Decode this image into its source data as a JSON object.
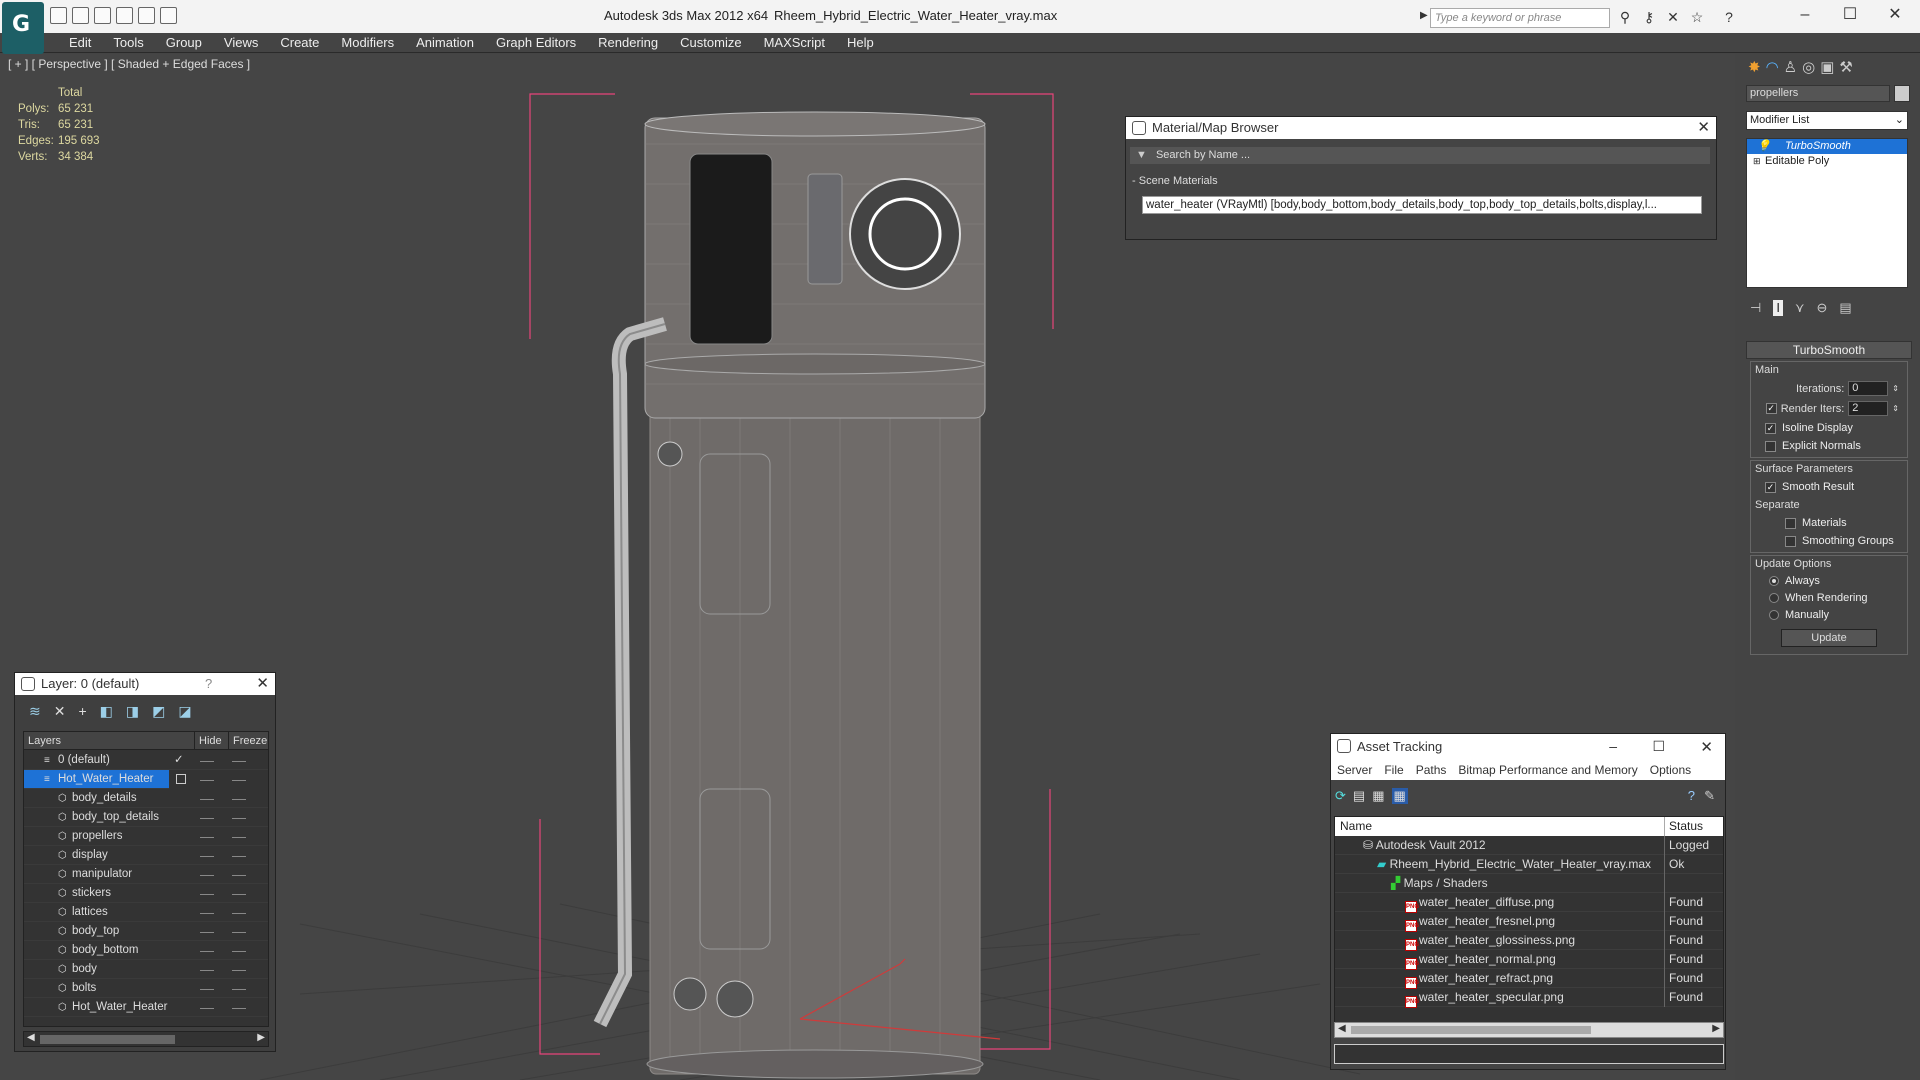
{
  "window": {
    "app_title": "Autodesk 3ds Max  2012 x64",
    "file_title": "Rheem_Hybrid_Electric_Water_Heater_vray.max",
    "search_placeholder": "Type a keyword or phrase"
  },
  "menu": [
    "Edit",
    "Tools",
    "Group",
    "Views",
    "Create",
    "Modifiers",
    "Animation",
    "Graph Editors",
    "Rendering",
    "Customize",
    "MAXScript",
    "Help"
  ],
  "viewport": {
    "label": "[ + ] [ Perspective ] [ Shaded + Edged Faces ]",
    "stats": {
      "header": "Total",
      "rows": [
        {
          "k": "Polys:",
          "v": "65 231"
        },
        {
          "k": "Tris:",
          "v": "65 231"
        },
        {
          "k": "Edges:",
          "v": "195 693"
        },
        {
          "k": "Verts:",
          "v": "34 384"
        }
      ]
    }
  },
  "material_browser": {
    "title": "Material/Map Browser",
    "search": "Search by Name ...",
    "section": "Scene Materials",
    "entry": "water_heater (VRayMtl) [body,body_bottom,body_details,body_top,body_top_details,bolts,display,l..."
  },
  "layer_dialog": {
    "title": "Layer: 0 (default)",
    "help": "?",
    "columns": {
      "name": "Layers",
      "hide": "Hide",
      "freeze": "Freeze"
    },
    "rows": [
      "0 (default)",
      "Hot_Water_Heater",
      "body_details",
      "body_top_details",
      "propellers",
      "display",
      "manipulator",
      "stickers",
      "lattices",
      "body_top",
      "body_bottom",
      "body",
      "bolts",
      "Hot_Water_Heater"
    ]
  },
  "asset_tracking": {
    "title": "Asset Tracking",
    "menu": [
      "Server",
      "File",
      "Paths",
      "Bitmap Performance and Memory",
      "Options"
    ],
    "columns": {
      "name": "Name",
      "status": "Status"
    },
    "rows": [
      {
        "name": "Autodesk Vault 2012",
        "status": "Logged Ou"
      },
      {
        "name": "Rheem_Hybrid_Electric_Water_Heater_vray.max",
        "status": "Ok"
      },
      {
        "name": "Maps / Shaders",
        "status": ""
      },
      {
        "name": "water_heater_diffuse.png",
        "status": "Found"
      },
      {
        "name": "water_heater_fresnel.png",
        "status": "Found"
      },
      {
        "name": "water_heater_glossiness.png",
        "status": "Found"
      },
      {
        "name": "water_heater_normal.png",
        "status": "Found"
      },
      {
        "name": "water_heater_refract.png",
        "status": "Found"
      },
      {
        "name": "water_heater_specular.png",
        "status": "Found"
      }
    ]
  },
  "command_panel": {
    "object_name": "propellers",
    "modifier_list": "Modifier List",
    "stack": [
      "TurboSmooth",
      "Editable Poly"
    ],
    "rollout": "TurboSmooth",
    "main_label": "Main",
    "iterations_label": "Iterations:",
    "iterations_value": "0",
    "render_iters_label": "Render Iters:",
    "render_iters_value": "2",
    "isoline": "Isoline Display",
    "explicit": "Explicit Normals",
    "surface_label": "Surface Parameters",
    "smooth_result": "Smooth Result",
    "separate": "Separate",
    "materials": "Materials",
    "smoothing_groups": "Smoothing Groups",
    "update_options": "Update Options",
    "always": "Always",
    "when_rendering": "When Rendering",
    "manually": "Manually",
    "update_button": "Update"
  },
  "colors": {
    "accent_selection": "#1e72d6",
    "stats_text": "#ddd8a0",
    "bbox_pink": "#e6457a"
  }
}
